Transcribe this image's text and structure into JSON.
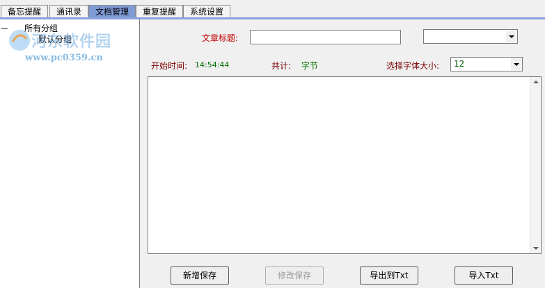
{
  "tabs": [
    {
      "label": "备忘提醒",
      "active": false
    },
    {
      "label": "通讯录",
      "active": false
    },
    {
      "label": "文档管理",
      "active": true
    },
    {
      "label": "重复提醒",
      "active": false
    },
    {
      "label": "系统设置",
      "active": false
    }
  ],
  "tree": {
    "root": "所有分组",
    "children": [
      "默认分组"
    ]
  },
  "watermark": {
    "title": "河东软件园",
    "url": "www.pc0359.cn"
  },
  "form": {
    "title_label": "文章标题:",
    "title_value": "",
    "category_value": "",
    "start_time_label": "开始时间:",
    "start_time_value": "14:54:44",
    "total_label": "共计:",
    "total_unit": "字节",
    "font_size_label": "选择字体大小:",
    "font_size_value": "12",
    "body_text": ""
  },
  "buttons": {
    "new_save": "新增保存",
    "modify_save": "修改保存",
    "export_txt": "导出到Txt",
    "import_txt": "导入Txt"
  },
  "colors": {
    "active_tab": "#7f9bd6",
    "label_red": "#c00000",
    "value_green": "#007000"
  }
}
